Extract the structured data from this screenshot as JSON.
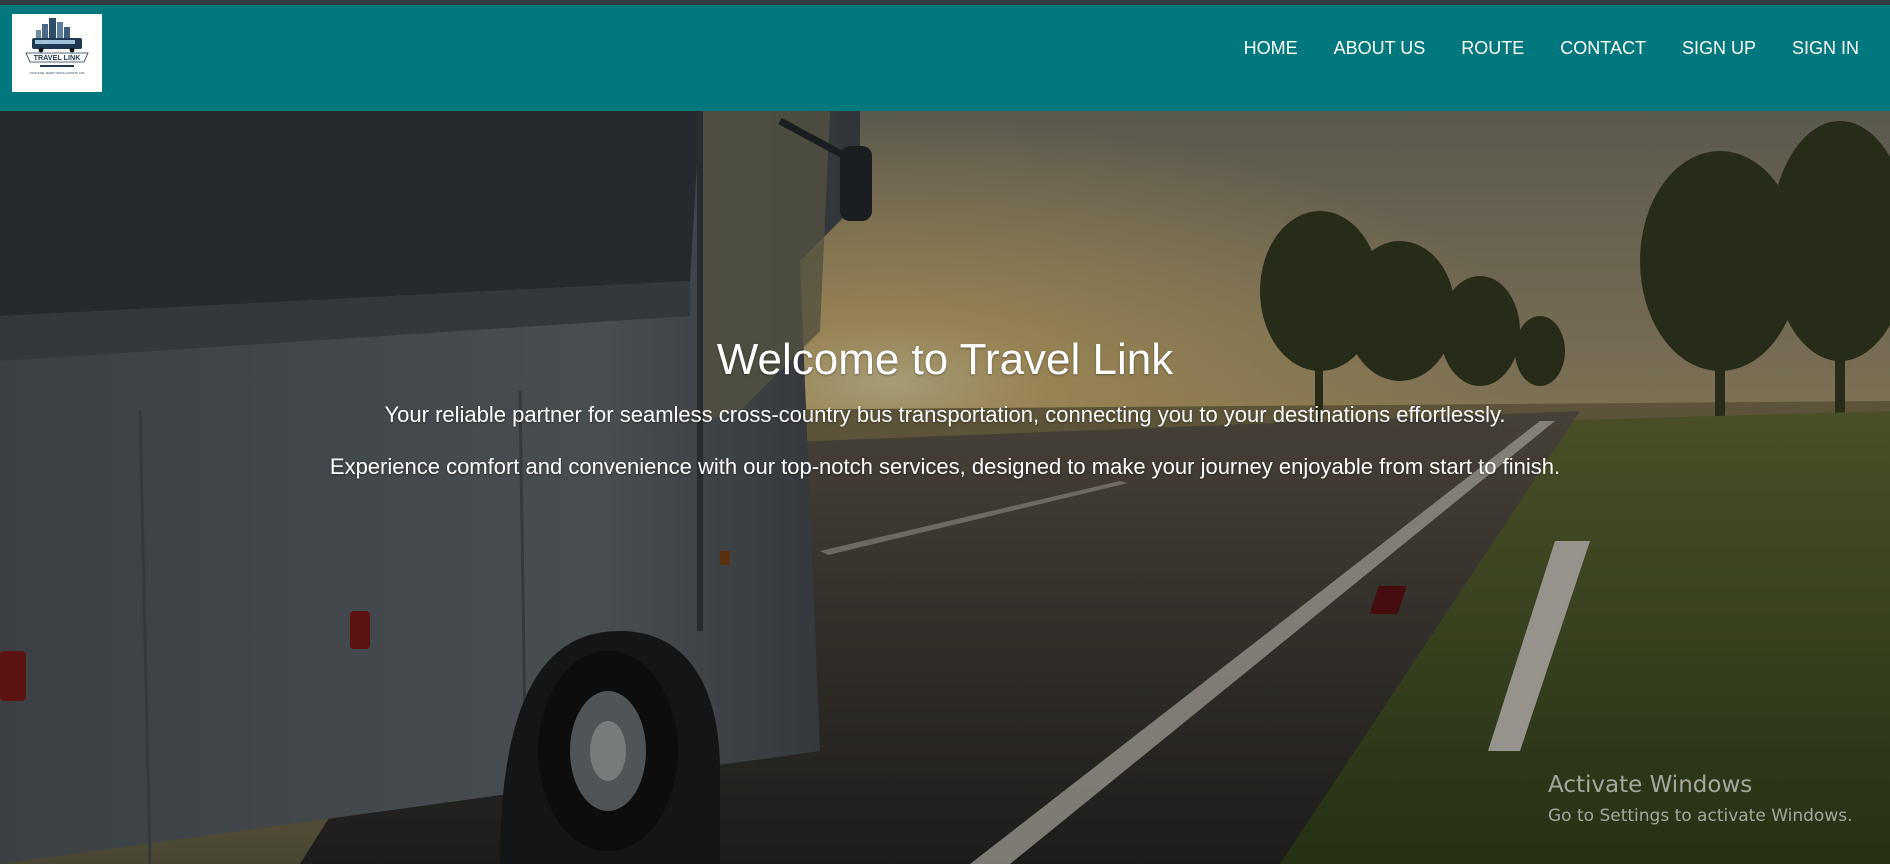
{
  "logo": {
    "brand_text": "TRAVEL LINK",
    "tagline_text": "YOUR SAFE, SMART CROSS-COUNTRY LINK",
    "icon": "bus-city-logo"
  },
  "nav": {
    "items": [
      {
        "label": "HOME"
      },
      {
        "label": "ABOUT US"
      },
      {
        "label": "ROUTE"
      },
      {
        "label": "CONTACT"
      },
      {
        "label": "SIGN UP"
      },
      {
        "label": "SIGN IN"
      }
    ]
  },
  "hero": {
    "title": "Welcome to Travel Link",
    "paragraph1": "Your reliable partner for seamless cross-country bus transportation, connecting you to your destinations effortlessly.",
    "paragraph2": "Experience comfort and convenience with our top-notch services, designed to make your journey enjoyable from start to finish.",
    "background_image": "bus-on-highway-at-sunset"
  },
  "watermark": {
    "title": "Activate Windows",
    "subtitle": "Go to Settings to activate Windows."
  },
  "colors": {
    "navbar": "#00787d",
    "top_strip": "#2f3b3c",
    "text": "#ffffff"
  }
}
